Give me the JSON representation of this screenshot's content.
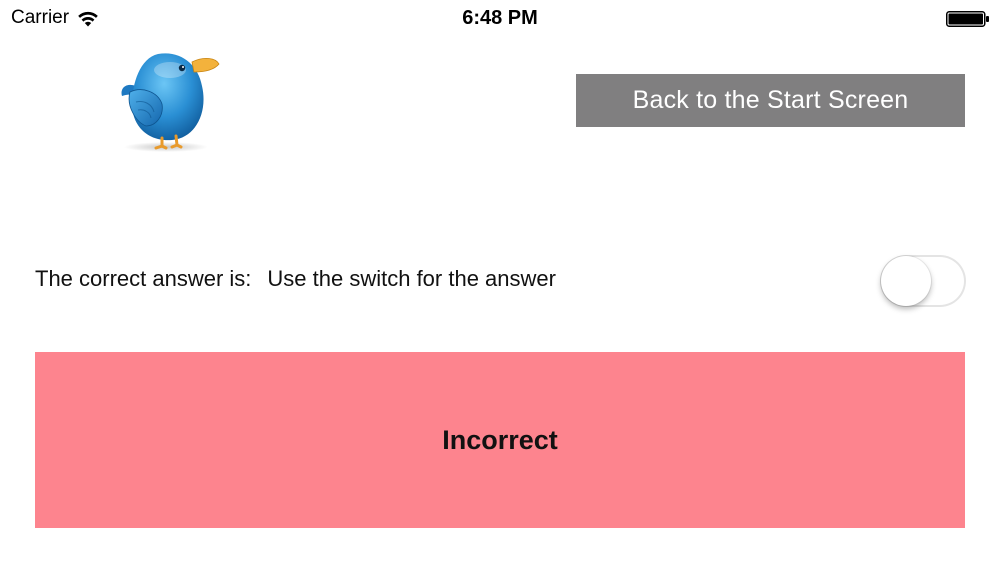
{
  "status_bar": {
    "carrier": "Carrier",
    "time": "6:48 PM",
    "wifi_icon": "wifi-icon",
    "battery_icon": "battery-full-icon"
  },
  "header": {
    "bird_icon": "bird-icon",
    "back_button_label": "Back to the Start Screen"
  },
  "answer": {
    "label": "The correct answer is:",
    "value": "Use the switch for the answer",
    "switch_on": false
  },
  "result": {
    "text": "Incorrect",
    "color": "#fd848e"
  },
  "colors": {
    "button_bg": "#807f80",
    "bird_blue": "#2a8fd4"
  }
}
